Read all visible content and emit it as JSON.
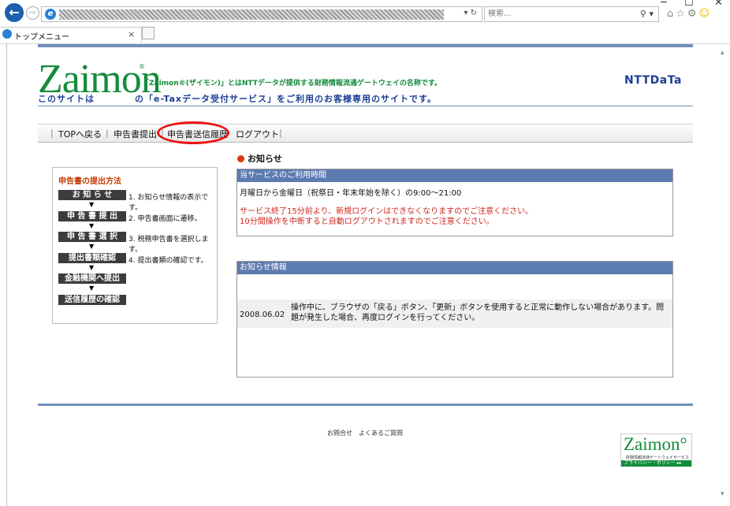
{
  "browser": {
    "window_controls": [
      "─",
      "☐",
      "✕"
    ],
    "back_icon": "←",
    "forward_icon": "⇨",
    "addr_tools": "▾ ↻",
    "search_placeholder": "検索...",
    "search_icon": "⚲ ▾",
    "right_icons": "⌂☆⚙",
    "smiley": "☺",
    "tab_title": "トップメニュー",
    "tab_close": "×"
  },
  "header": {
    "logo": "Zaimon",
    "logo_reg": "®",
    "tagline": "「Zaimon®(ザイモン)」とはNTTデータが提供する財務情報流通ゲートウェイの名称です。",
    "line2_a": "このサイトは",
    "line2_b": "の「e-Taxデータ受付サービス」をご利用のお客様専用のサイトです。",
    "brand": "NTTDaTa"
  },
  "nav": {
    "items": [
      "TOPへ戻る",
      "申告書提出",
      "申告書送信履歴",
      "ログアウト"
    ],
    "sep": "|"
  },
  "howto": {
    "title": "申告書の提出方法",
    "arrow": "▼",
    "steps": [
      {
        "label": "お 知 ら せ",
        "desc": "1. お知らせ情報の表示です。"
      },
      {
        "label": "申 告 書 提 出",
        "desc": "2. 申告書画面に遷移。"
      },
      {
        "label": "申 告 書 選 択",
        "desc": "3. 税務申告書を選択します。"
      },
      {
        "label": "提出書類確認",
        "desc": "4. 提出書類の確認です。"
      },
      {
        "label": "金融機関へ提出",
        "desc": ""
      },
      {
        "label": "送信履歴の確認",
        "desc": ""
      }
    ]
  },
  "notice": {
    "heading": "お知らせ",
    "hours_title": "当サービスのご利用時間",
    "hours": "月曜日から金曜日（祝祭日・年末年始を除く）の9:00〜21:00",
    "warn1": "サービス終了15分前より、新規ログインはできなくなりますのでご注意ください。",
    "warn2": "10分間操作を中断すると自動ログアウトされますのでご注意ください。",
    "info_title": "お知らせ情報",
    "item_date": "2008.06.02",
    "item_text": "操作中に、ブラウザの「戻る」ボタン、「更新」ボタンを使用すると正常に動作しない場合があります。問題が発生した場合、再度ログインを行ってください。"
  },
  "footer": {
    "links": "お問合せ　よくあるご質問",
    "logo": "Zaimon°",
    "logo_sub": "財務情報流通ゲートウェイサービス",
    "policy": "プライバシー・ポリシー ▸▸"
  }
}
